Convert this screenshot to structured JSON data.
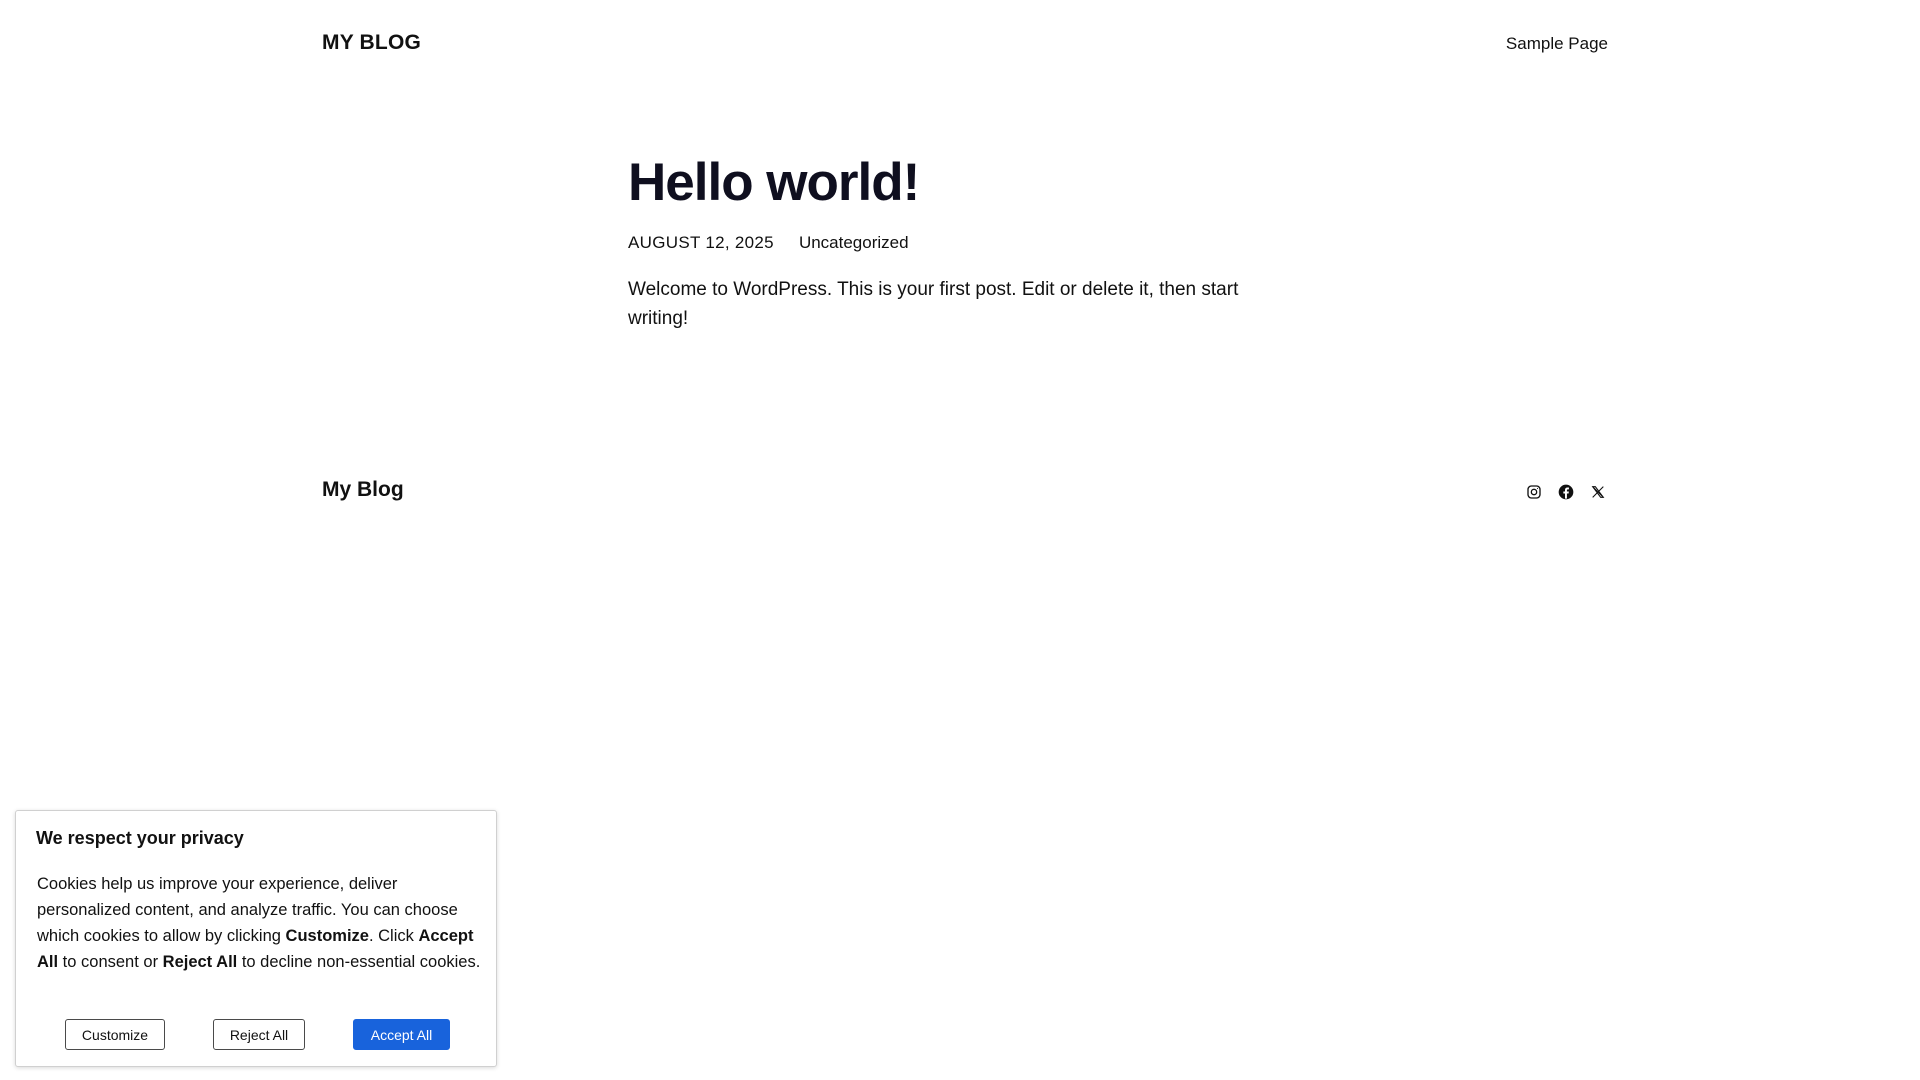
{
  "header": {
    "site_title": "MY BLOG",
    "nav": [
      {
        "label": "Sample Page"
      }
    ]
  },
  "post": {
    "title": "Hello world!",
    "date": "AUGUST 12, 2025",
    "category": "Uncategorized",
    "content": "Welcome to WordPress. This is your first post. Edit or delete it, then start writing!"
  },
  "footer": {
    "site_title": "My Blog",
    "social_icons": [
      "instagram-icon",
      "facebook-icon",
      "x-icon"
    ]
  },
  "cookie_banner": {
    "title": "We respect your privacy",
    "text_part1": "Cookies help us improve your experience, deliver personalized content, and analyze traffic. You can choose which cookies to allow by clicking ",
    "bold_customize": "Customize",
    "text_part2": ". Click ",
    "bold_accept": "Accept All",
    "text_part3": " to consent or ",
    "bold_reject": "Reject All",
    "text_part4": " to decline non-essential cookies.",
    "buttons": {
      "customize": "Customize",
      "reject": "Reject All",
      "accept": "Accept All"
    },
    "accent_color": "#1863dc"
  }
}
